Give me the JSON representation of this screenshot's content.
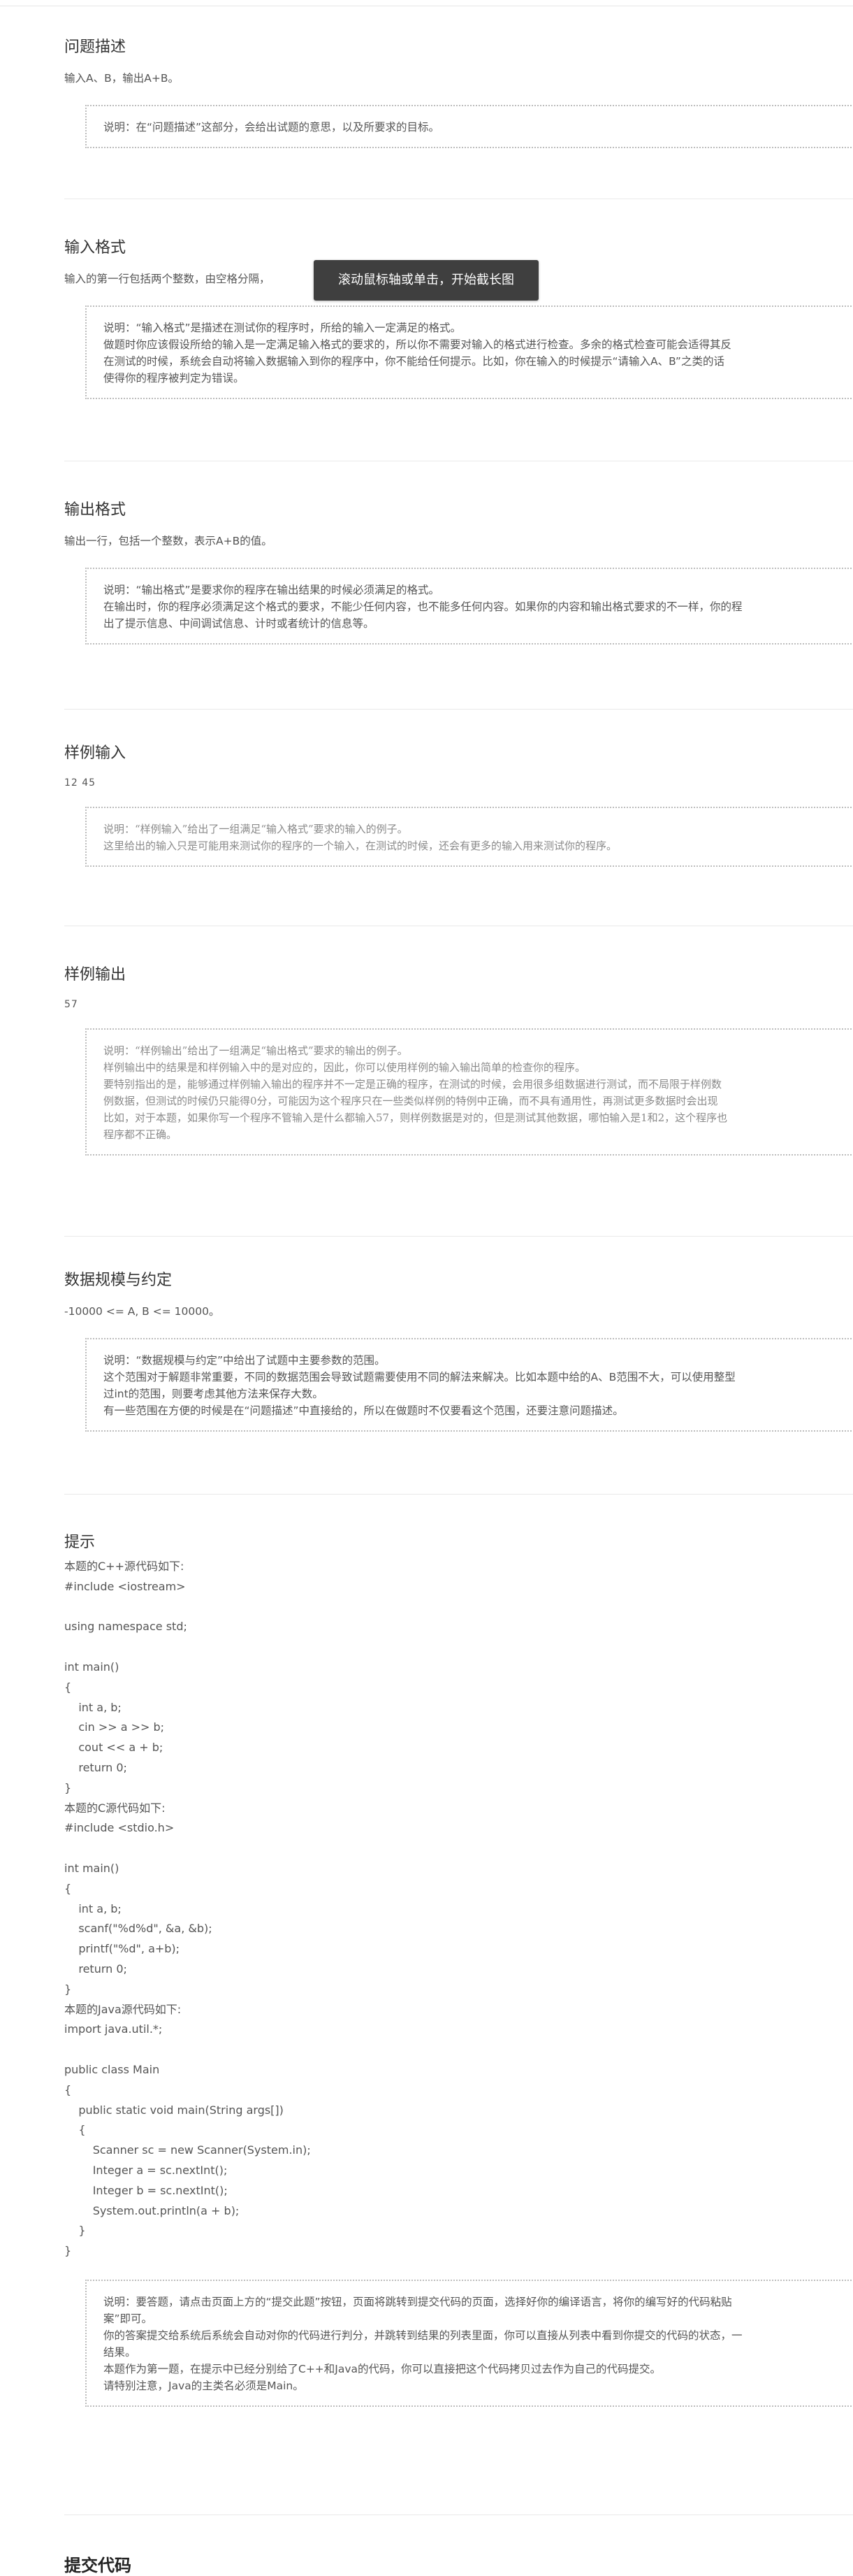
{
  "sections": {
    "problem": {
      "title": "问题描述",
      "text": "输入A、B，输出A+B。",
      "note": [
        "说明：在“问题描述”这部分，会给出试题的意思，以及所要求的目标。"
      ]
    },
    "input_format": {
      "title": "输入格式",
      "text": "输入的第一行包括两个整数，由空格分隔，",
      "note": [
        "说明：“输入格式”是描述在测试你的程序时，所给的输入一定满足的格式。",
        "做题时你应该假设所给的输入是一定满足输入格式的要求的，所以你不需要对输入的格式进行检查。多余的格式检查可能会适得其反",
        "在测试的时候，系统会自动将输入数据输入到你的程序中，你不能给任何提示。比如，你在输入的时候提示“请输入A、B”之类的话",
        "使得你的程序被判定为错误。"
      ]
    },
    "output_format": {
      "title": "输出格式",
      "text": "输出一行，包括一个整数，表示A+B的值。",
      "note": [
        "说明：“输出格式”是要求你的程序在输出结果的时候必须满足的格式。",
        "在输出时，你的程序必须满足这个格式的要求，不能少任何内容，也不能多任何内容。如果你的内容和输出格式要求的不一样，你的程",
        "出了提示信息、中间调试信息、计时或者统计的信息等。"
      ]
    },
    "sample_input": {
      "title": "样例输入",
      "value": "12 45",
      "note": [
        "说明：“样例输入”给出了一组满足“输入格式”要求的输入的例子。",
        "这里给出的输入只是可能用来测试你的程序的一个输入，在测试的时候，还会有更多的输入用来测试你的程序。"
      ]
    },
    "sample_output": {
      "title": "样例输出",
      "value": "57",
      "note": [
        "说明：“样例输出”给出了一组满足“输出格式”要求的输出的例子。",
        "样例输出中的结果是和样例输入中的是对应的，因此，你可以使用样例的输入输出简单的检查你的程序。",
        "要特别指出的是，能够通过样例输入输出的程序并不一定是正确的程序，在测试的时候，会用很多组数据进行测试，而不局限于样例数",
        "例数据，但测试的时候仍只能得0分，可能因为这个程序只在一些类似样例的特例中正确，而不具有通用性，再测试更多数据时会出现",
        "比如，对于本题，如果你写一个程序不管输入是什么都输入57，则样例数据是对的，但是测试其他数据，哪怕输入是1和2，这个程序也",
        "程序都不正确。"
      ]
    },
    "data_scale": {
      "title": "数据规模与约定",
      "text": "-10000 <= A, B <= 10000。",
      "note": [
        "说明：“数据规模与约定”中给出了试题中主要参数的范围。",
        "这个范围对于解题非常重要，不同的数据范围会导致试题需要使用不同的解法来解决。比如本题中给的A、B范围不大，可以使用整型",
        "过int的范围，则要考虑其他方法来保存大数。",
        "有一些范围在方便的时候是在“问题描述”中直接给的，所以在做题时不仅要看这个范围，还要注意问题描述。"
      ]
    },
    "hint": {
      "title": "提示",
      "code_lines": [
        "本题的C++源代码如下:",
        "#include <iostream>",
        "",
        "using namespace std;",
        "",
        "int main()",
        "{",
        "    int a, b;",
        "    cin >> a >> b;",
        "    cout << a + b;",
        "    return 0;",
        "}",
        "本题的C源代码如下:",
        "#include <stdio.h>",
        "",
        "int main()",
        "{",
        "    int a, b;",
        "    scanf(\"%d%d\", &a, &b);",
        "    printf(\"%d\", a+b);",
        "    return 0;",
        "}",
        "本题的Java源代码如下:",
        "import java.util.*;",
        "",
        "public class Main",
        "{",
        "    public static void main(String args[])",
        "    {",
        "        Scanner sc = new Scanner(System.in);",
        "        Integer a = sc.nextInt();",
        "        Integer b = sc.nextInt();",
        "        System.out.println(a + b);",
        "    }",
        "}"
      ],
      "note": [
        "说明：要答题，请点击页面上方的“提交此题”按钮，页面将跳转到提交代码的页面，选择好你的编译语言，将你的编写好的代码粘贴",
        "案”即可。",
        "你的答案提交给系统后系统会自动对你的代码进行判分，并跳转到结果的列表里面，你可以直接从列表中看到你提交的代码的状态，一",
        "结果。",
        "本题作为第一题，在提示中已经分别给了C++和Java的代码，你可以直接把这个代码拷贝过去作为自己的代码提交。",
        "请特别注意，Java的主类名必须是Main。"
      ]
    },
    "submit": {
      "title": "提交代码"
    }
  },
  "tooltip": "滚动鼠标轴或单击，开始截长图"
}
